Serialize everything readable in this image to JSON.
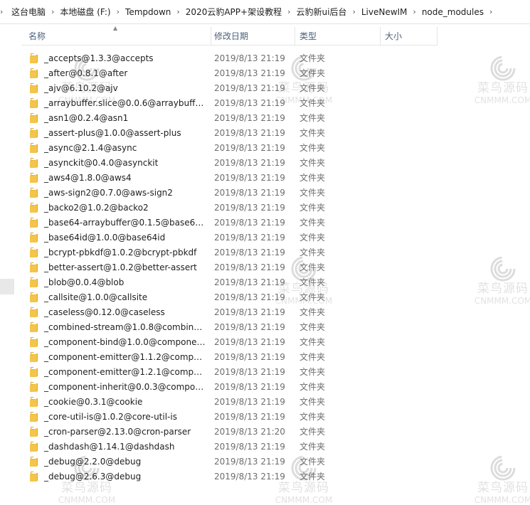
{
  "breadcrumb": [
    "这台电脑",
    "本地磁盘 (F:)",
    "Tempdown",
    "2020云豹APP+架设教程",
    "云豹新ui后台",
    "LiveNewIM",
    "node_modules"
  ],
  "columns": {
    "name": "名称",
    "date": "修改日期",
    "type": "类型",
    "size": "大小"
  },
  "icons": {
    "folder": "folder-icon",
    "sort": "sort-up-arrow-icon",
    "separator": "chevron-right-icon"
  },
  "colors": {
    "folder": "#f3c54b",
    "folder_dark": "#dfa823",
    "header_text": "#4c607a"
  },
  "watermark": {
    "title": "菜鸟源码",
    "url": "CNMMM.COM"
  },
  "files": [
    {
      "name": "_accepts@1.3.3@accepts",
      "date": "2019/8/13 21:19",
      "type": "文件夹"
    },
    {
      "name": "_after@0.8.1@after",
      "date": "2019/8/13 21:19",
      "type": "文件夹"
    },
    {
      "name": "_ajv@6.10.2@ajv",
      "date": "2019/8/13 21:19",
      "type": "文件夹"
    },
    {
      "name": "_arraybuffer.slice@0.0.6@arraybuffer....",
      "date": "2019/8/13 21:19",
      "type": "文件夹"
    },
    {
      "name": "_asn1@0.2.4@asn1",
      "date": "2019/8/13 21:19",
      "type": "文件夹"
    },
    {
      "name": "_assert-plus@1.0.0@assert-plus",
      "date": "2019/8/13 21:19",
      "type": "文件夹"
    },
    {
      "name": "_async@2.1.4@async",
      "date": "2019/8/13 21:19",
      "type": "文件夹"
    },
    {
      "name": "_asynckit@0.4.0@asynckit",
      "date": "2019/8/13 21:19",
      "type": "文件夹"
    },
    {
      "name": "_aws4@1.8.0@aws4",
      "date": "2019/8/13 21:19",
      "type": "文件夹"
    },
    {
      "name": "_aws-sign2@0.7.0@aws-sign2",
      "date": "2019/8/13 21:19",
      "type": "文件夹"
    },
    {
      "name": "_backo2@1.0.2@backo2",
      "date": "2019/8/13 21:19",
      "type": "文件夹"
    },
    {
      "name": "_base64-arraybuffer@0.1.5@base64-...",
      "date": "2019/8/13 21:19",
      "type": "文件夹"
    },
    {
      "name": "_base64id@1.0.0@base64id",
      "date": "2019/8/13 21:19",
      "type": "文件夹"
    },
    {
      "name": "_bcrypt-pbkdf@1.0.2@bcrypt-pbkdf",
      "date": "2019/8/13 21:19",
      "type": "文件夹"
    },
    {
      "name": "_better-assert@1.0.2@better-assert",
      "date": "2019/8/13 21:19",
      "type": "文件夹"
    },
    {
      "name": "_blob@0.0.4@blob",
      "date": "2019/8/13 21:19",
      "type": "文件夹"
    },
    {
      "name": "_callsite@1.0.0@callsite",
      "date": "2019/8/13 21:19",
      "type": "文件夹"
    },
    {
      "name": "_caseless@0.12.0@caseless",
      "date": "2019/8/13 21:19",
      "type": "文件夹"
    },
    {
      "name": "_combined-stream@1.0.8@combined...",
      "date": "2019/8/13 21:19",
      "type": "文件夹"
    },
    {
      "name": "_component-bind@1.0.0@componen...",
      "date": "2019/8/13 21:19",
      "type": "文件夹"
    },
    {
      "name": "_component-emitter@1.1.2@compon...",
      "date": "2019/8/13 21:19",
      "type": "文件夹"
    },
    {
      "name": "_component-emitter@1.2.1@compon...",
      "date": "2019/8/13 21:19",
      "type": "文件夹"
    },
    {
      "name": "_component-inherit@0.0.3@compon...",
      "date": "2019/8/13 21:19",
      "type": "文件夹"
    },
    {
      "name": "_cookie@0.3.1@cookie",
      "date": "2019/8/13 21:19",
      "type": "文件夹"
    },
    {
      "name": "_core-util-is@1.0.2@core-util-is",
      "date": "2019/8/13 21:19",
      "type": "文件夹"
    },
    {
      "name": "_cron-parser@2.13.0@cron-parser",
      "date": "2019/8/13 21:20",
      "type": "文件夹"
    },
    {
      "name": "_dashdash@1.14.1@dashdash",
      "date": "2019/8/13 21:19",
      "type": "文件夹"
    },
    {
      "name": "_debug@2.2.0@debug",
      "date": "2019/8/13 21:19",
      "type": "文件夹"
    },
    {
      "name": "_debug@2.6.3@debug",
      "date": "2019/8/13 21:19",
      "type": "文件夹"
    }
  ]
}
